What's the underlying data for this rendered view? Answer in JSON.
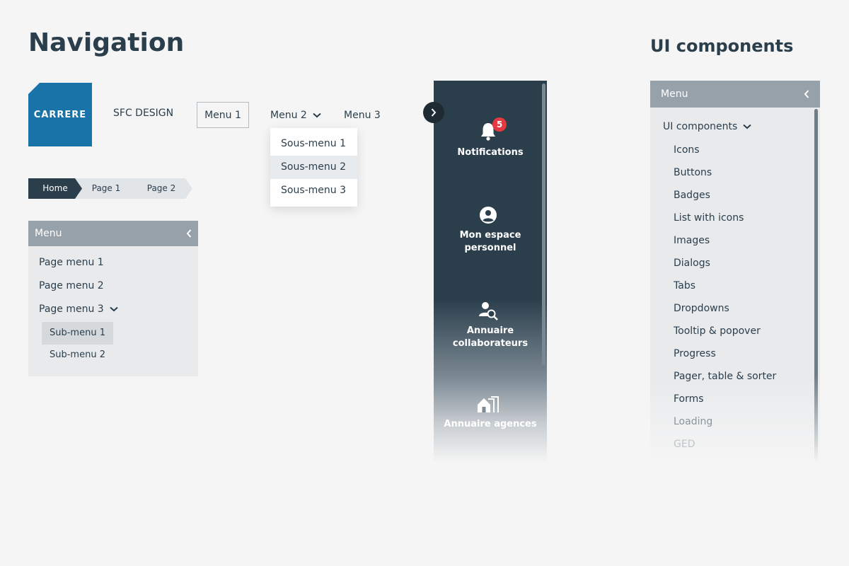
{
  "titles": {
    "page": "Navigation",
    "section": "UI components"
  },
  "logo": {
    "text": "CARRERE"
  },
  "brand": {
    "text": "SFC DESIGN"
  },
  "topnav": {
    "menu1": "Menu 1",
    "menu2": "Menu 2",
    "menu3": "Menu 3"
  },
  "dropdown": {
    "items": [
      {
        "label": "Sous-menu 1",
        "active": false
      },
      {
        "label": "Sous-menu 2",
        "active": true
      },
      {
        "label": "Sous-menu 3",
        "active": false
      }
    ]
  },
  "breadcrumb": {
    "items": [
      "Home",
      "Page 1",
      "Page 2"
    ]
  },
  "sidemenu": {
    "header": "Menu",
    "items": [
      "Page menu 1",
      "Page menu 2",
      "Page menu 3"
    ],
    "subitems": [
      "Sub-menu 1",
      "Sub-menu 2"
    ]
  },
  "dark_sidebar": {
    "items": [
      {
        "label": "Notifications",
        "icon": "bell-icon",
        "badge": "5"
      },
      {
        "label": "Mon espace personnel",
        "icon": "user-circle-icon"
      },
      {
        "label": "Annuaire collaborateurs",
        "icon": "user-search-icon"
      },
      {
        "label": "Annuaire agences",
        "icon": "buildings-icon"
      }
    ]
  },
  "components_menu": {
    "header": "Menu",
    "group": "UI components",
    "items": [
      "Icons",
      "Buttons",
      "Badges",
      "List with icons",
      "Images",
      "Dialogs",
      "Tabs",
      "Dropdowns",
      "Tooltip & popover",
      "Progress",
      "Pager, table & sorter",
      "Forms",
      "Loading",
      "GED"
    ]
  },
  "colors": {
    "primary_dark": "#2b3e4c",
    "logo_blue": "#1a73a8",
    "menu_header": "#96a1a9",
    "badge_red": "#e53941"
  }
}
